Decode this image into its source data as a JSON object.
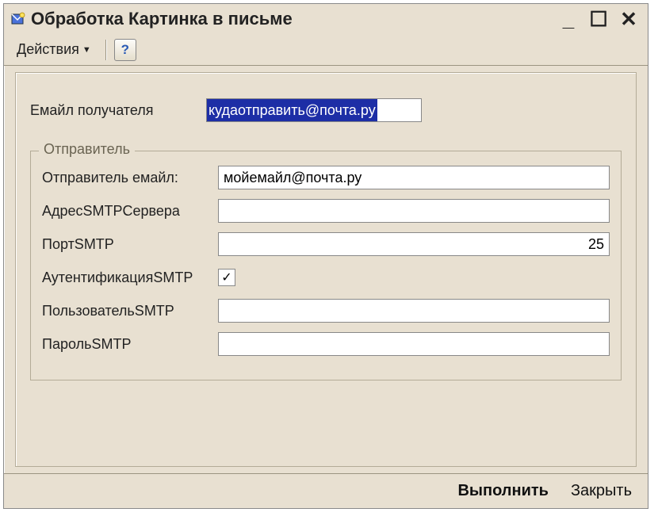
{
  "window": {
    "title": "Обработка  Картинка в письме"
  },
  "toolbar": {
    "actions_label": "Действия"
  },
  "form": {
    "recipient_label": "Емайл получателя",
    "recipient_value": "кудаотправить@почта.ру"
  },
  "sender": {
    "legend": "Отправитель",
    "email_label": "Отправитель емайл:",
    "email_value": "мойемайл@почта.ру",
    "smtp_server_label": "АдресSMTPСервера",
    "smtp_server_value": "",
    "smtp_port_label": "ПортSMTP",
    "smtp_port_value": "25",
    "smtp_auth_label": "АутентификацияSMTP",
    "smtp_auth_checked": "✓",
    "smtp_user_label": "ПользовательSMTP",
    "smtp_user_value": "",
    "smtp_pass_label": "ПарольSMTP",
    "smtp_pass_value": ""
  },
  "footer": {
    "execute": "Выполнить",
    "close": "Закрыть"
  }
}
